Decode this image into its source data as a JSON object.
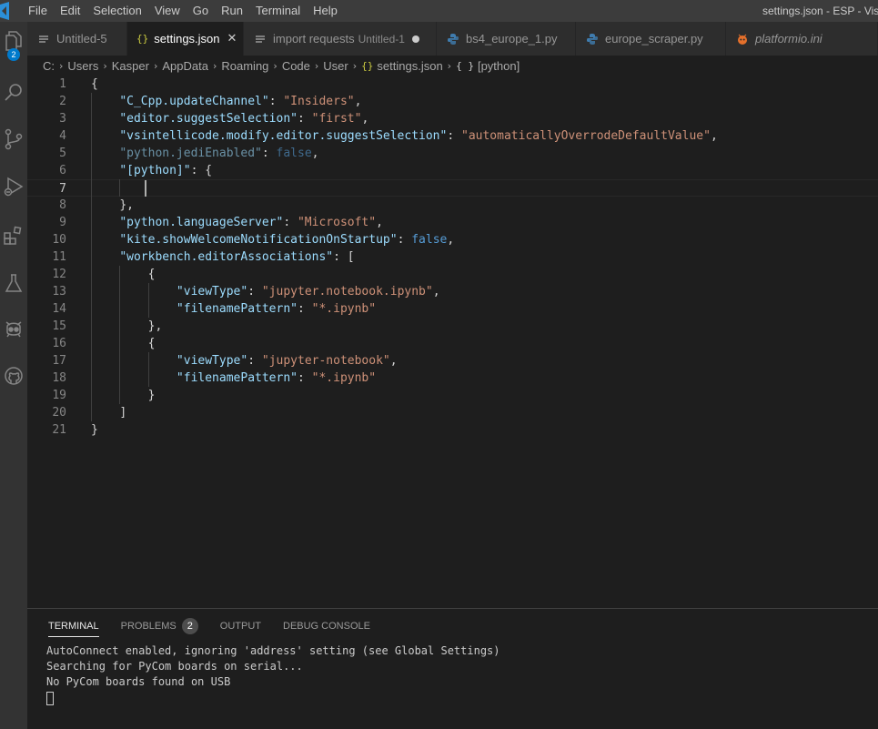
{
  "titlebar": {
    "menu": [
      "File",
      "Edit",
      "Selection",
      "View",
      "Go",
      "Run",
      "Terminal",
      "Help"
    ],
    "window_title": "settings.json - ESP - Visu"
  },
  "activity_bar": {
    "items": [
      "explorer-icon",
      "search-icon",
      "source-control-icon",
      "run-debug-icon",
      "extensions-icon",
      "testing-icon",
      "platformio-icon",
      "github-icon"
    ],
    "explorer_badge": "2"
  },
  "tabs": [
    {
      "label": "Untitled-5",
      "icon": "menu-lines",
      "state": "close"
    },
    {
      "label": "settings.json",
      "icon": "{}",
      "state": "close",
      "active": true
    },
    {
      "label": "import requests",
      "desc": "Untitled-1",
      "icon": "menu-lines",
      "state": "dirty"
    },
    {
      "label": "bs4_europe_1.py",
      "icon": "python"
    },
    {
      "label": "europe_scraper.py",
      "icon": "python"
    },
    {
      "label": "platformio.ini",
      "icon": "platformio",
      "italic": true
    }
  ],
  "breadcrumb": {
    "parts": [
      "C:",
      "Users",
      "Kasper",
      "AppData",
      "Roaming",
      "Code",
      "User"
    ],
    "file_icon": "{}",
    "file": "settings.json",
    "symbol_icon": "{ }",
    "symbol": "[python]"
  },
  "editor": {
    "current_line": 7,
    "lines": [
      "{",
      "    \"C_Cpp.updateChannel\": \"Insiders\",",
      "    \"editor.suggestSelection\": \"first\",",
      "    \"vsintellicode.modify.editor.suggestSelection\": \"automaticallyOverrodeDefaultValue\",",
      "    \"python.jediEnabled\": false,",
      "    \"[python]\": {",
      "        ",
      "    },",
      "    \"python.languageServer\": \"Microsoft\",",
      "    \"kite.showWelcomeNotificationOnStartup\": false,",
      "    \"workbench.editorAssociations\": [",
      "        {",
      "            \"viewType\": \"jupyter.notebook.ipynb\",",
      "            \"filenamePattern\": \"*.ipynb\"",
      "        },",
      "        {",
      "            \"viewType\": \"jupyter-notebook\",",
      "            \"filenamePattern\": \"*.ipynb\"",
      "        }",
      "    ]",
      "}"
    ]
  },
  "panel": {
    "tabs": [
      "TERMINAL",
      "PROBLEMS",
      "OUTPUT",
      "DEBUG CONSOLE"
    ],
    "problems_count": "2",
    "active_tab": "TERMINAL",
    "terminal_lines": [
      "AutoConnect enabled, ignoring 'address' setting (see Global Settings)",
      "Searching for PyCom boards on serial...",
      "No PyCom boards found on USB"
    ]
  },
  "colors": {
    "key": "#9cdcfe",
    "string": "#ce9178",
    "boolean": "#569cd6",
    "accent": "#007acc"
  }
}
